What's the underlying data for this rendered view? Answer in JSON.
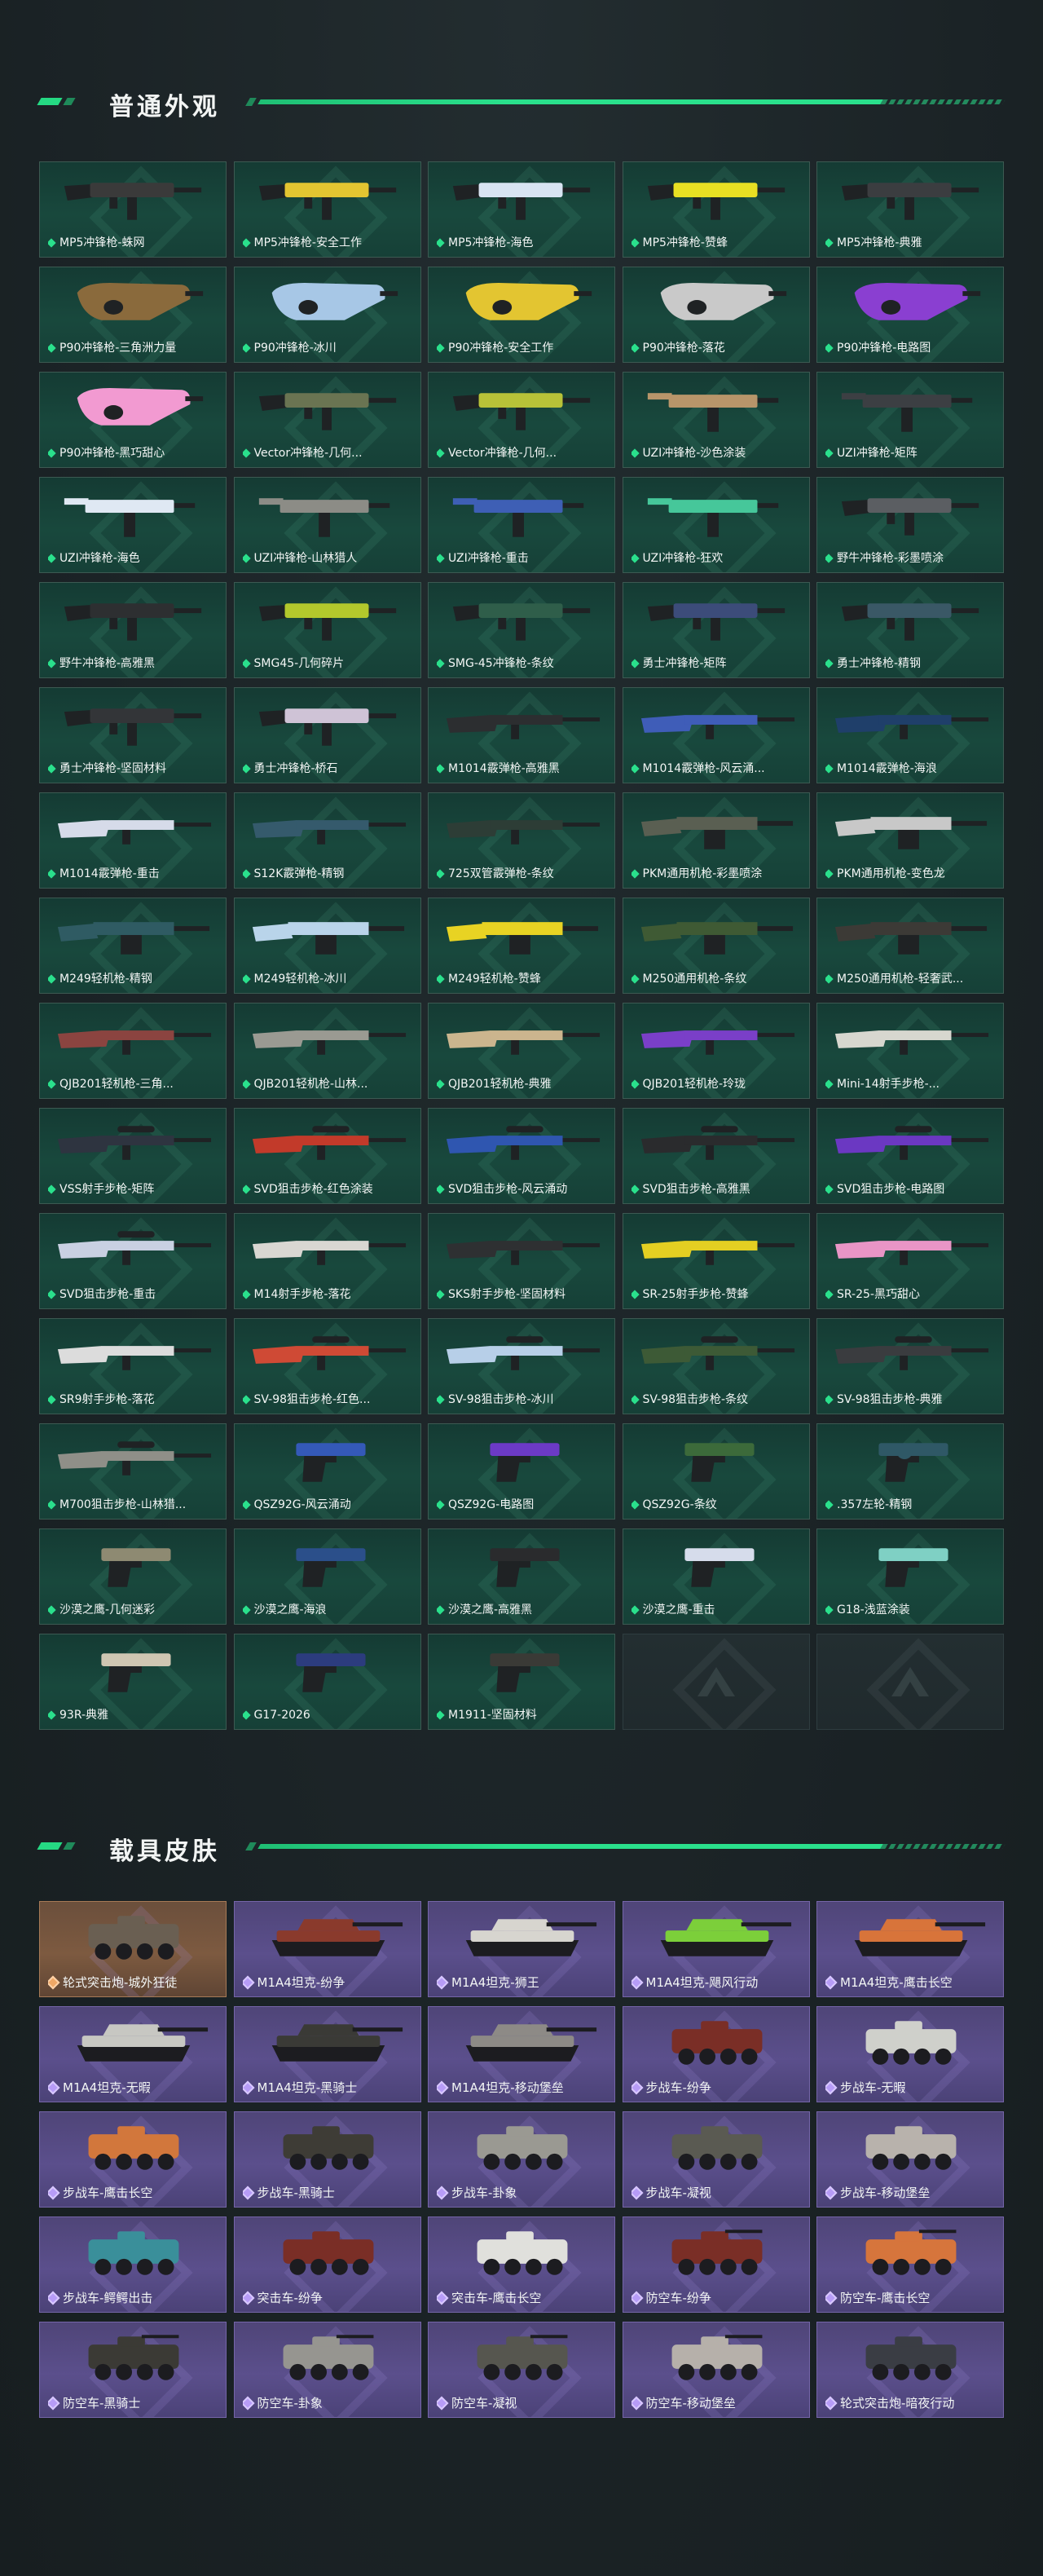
{
  "colors": {
    "accent": "#2ae08c",
    "weapon_card": "#184a3e",
    "vehicle_card": "#5b4f8c",
    "vehicle_legend_card": "#7d5a40",
    "page_bg": "#1c2427"
  },
  "weapons_section": {
    "title": "普通外观",
    "items": [
      {
        "label": "MP5冲锋枪-蛛网",
        "icon": "smg-icon",
        "tone": "#3a3a3a"
      },
      {
        "label": "MP5冲锋枪-安全工作",
        "icon": "smg-icon",
        "tone": "#e3c531"
      },
      {
        "label": "MP5冲锋枪-海色",
        "icon": "smg-icon",
        "tone": "#d8e4f2"
      },
      {
        "label": "MP5冲锋枪-赞蜂",
        "icon": "smg-icon",
        "tone": "#e8e023"
      },
      {
        "label": "MP5冲锋枪-典雅",
        "icon": "smg-icon",
        "tone": "#3b3d40"
      },
      {
        "label": "P90冲锋枪-三角洲力量",
        "icon": "p90-icon",
        "tone": "#8a6a3c"
      },
      {
        "label": "P90冲锋枪-冰川",
        "icon": "p90-icon",
        "tone": "#a7c7e6"
      },
      {
        "label": "P90冲锋枪-安全工作",
        "icon": "p90-icon",
        "tone": "#e3c531"
      },
      {
        "label": "P90冲锋枪-落花",
        "icon": "p90-icon",
        "tone": "#c9c9c9"
      },
      {
        "label": "P90冲锋枪-电路图",
        "icon": "p90-icon",
        "tone": "#8a3fd1"
      },
      {
        "label": "P90冲锋枪-黑巧甜心",
        "icon": "p90-icon",
        "tone": "#f29ad1"
      },
      {
        "label": "Vector冲锋枪-几何...",
        "icon": "smg-icon",
        "tone": "#6a7452"
      },
      {
        "label": "Vector冲锋枪-几何...",
        "icon": "smg-icon",
        "tone": "#b8c238"
      },
      {
        "label": "UZI冲锋枪-沙色涂装",
        "icon": "uzi-icon",
        "tone": "#b8956a"
      },
      {
        "label": "UZI冲锋枪-矩阵",
        "icon": "uzi-icon",
        "tone": "#3c3f43"
      },
      {
        "label": "UZI冲锋枪-海色",
        "icon": "uzi-icon",
        "tone": "#dfe8f3"
      },
      {
        "label": "UZI冲锋枪-山林猎人",
        "icon": "uzi-icon",
        "tone": "#8c8c86"
      },
      {
        "label": "UZI冲锋枪-重击",
        "icon": "uzi-icon",
        "tone": "#3e5fb5"
      },
      {
        "label": "UZI冲锋枪-狂欢",
        "icon": "uzi-icon",
        "tone": "#46c79a"
      },
      {
        "label": "野牛冲锋枪-彩墨喷涂",
        "icon": "smg-icon",
        "tone": "#5b5e62"
      },
      {
        "label": "野牛冲锋枪-高雅黑",
        "icon": "smg-icon",
        "tone": "#2d2f31"
      },
      {
        "label": "SMG45-几何碎片",
        "icon": "smg-icon",
        "tone": "#b3c82c"
      },
      {
        "label": "SMG-45冲锋枪-条纹",
        "icon": "smg-icon",
        "tone": "#2f5e4a"
      },
      {
        "label": "勇士冲锋枪-矩阵",
        "icon": "smg-icon",
        "tone": "#3c4c7a"
      },
      {
        "label": "勇士冲锋枪-精钢",
        "icon": "smg-icon",
        "tone": "#3a5866"
      },
      {
        "label": "勇士冲锋枪-坚固材料",
        "icon": "smg-icon",
        "tone": "#333538"
      },
      {
        "label": "勇士冲锋枪-桥石",
        "icon": "smg-icon",
        "tone": "#cfc3d6"
      },
      {
        "label": "M1014霰弹枪-高雅黑",
        "icon": "shotgun-icon",
        "tone": "#2c2e30"
      },
      {
        "label": "M1014霰弹枪-风云涌...",
        "icon": "shotgun-icon",
        "tone": "#3f5db8"
      },
      {
        "label": "M1014霰弹枪-海浪",
        "icon": "shotgun-icon",
        "tone": "#1f3f6a"
      },
      {
        "label": "M1014霰弹枪-重击",
        "icon": "shotgun-icon",
        "tone": "#d6dbe9"
      },
      {
        "label": "S12K霰弹枪-精钢",
        "icon": "shotgun-icon",
        "tone": "#355a6c"
      },
      {
        "label": "725双管霰弹枪-条纹",
        "icon": "shotgun-icon",
        "tone": "#2d3d36"
      },
      {
        "label": "PKM通用机枪-彩墨喷涂",
        "icon": "mg-icon",
        "tone": "#5a5f52"
      },
      {
        "label": "PKM通用机枪-变色龙",
        "icon": "mg-icon",
        "tone": "#c8c8c8"
      },
      {
        "label": "M249轻机枪-精钢",
        "icon": "mg-icon",
        "tone": "#2f5b63"
      },
      {
        "label": "M249轻机枪-冰川",
        "icon": "mg-icon",
        "tone": "#b9d4ea"
      },
      {
        "label": "M249轻机枪-赞蜂",
        "icon": "mg-icon",
        "tone": "#e8d323"
      },
      {
        "label": "M250通用机枪-条纹",
        "icon": "mg-icon",
        "tone": "#3f5a34"
      },
      {
        "label": "M250通用机枪-轻奢武...",
        "icon": "mg-icon",
        "tone": "#3c3a36"
      },
      {
        "label": "QJB201轻机枪-三角...",
        "icon": "rifle-icon",
        "tone": "#8b4440"
      },
      {
        "label": "QJB201轻机枪-山林...",
        "icon": "rifle-icon",
        "tone": "#9a9a92"
      },
      {
        "label": "QJB201轻机枪-典雅",
        "icon": "rifle-icon",
        "tone": "#cbb58e"
      },
      {
        "label": "QJB201轻机枪-玲珑",
        "icon": "rifle-icon",
        "tone": "#7a3fc8"
      },
      {
        "label": "Mini-14射手步枪-...",
        "icon": "rifle-icon",
        "tone": "#d7d7cf"
      },
      {
        "label": "VSS射手步枪-矩阵",
        "icon": "sniper-icon",
        "tone": "#2e3440"
      },
      {
        "label": "SVD狙击步枪-红色涂装",
        "icon": "sniper-icon",
        "tone": "#c23a2a"
      },
      {
        "label": "SVD狙击步枪-风云涌动",
        "icon": "sniper-icon",
        "tone": "#2f56b0"
      },
      {
        "label": "SVD狙击步枪-高雅黑",
        "icon": "sniper-icon",
        "tone": "#2a2b2d"
      },
      {
        "label": "SVD狙击步枪-电路图",
        "icon": "sniper-icon",
        "tone": "#6b38c2"
      },
      {
        "label": "SVD狙击步枪-重击",
        "icon": "sniper-icon",
        "tone": "#c9d0e2"
      },
      {
        "label": "M14射手步枪-落花",
        "icon": "rifle-icon",
        "tone": "#d9d7d2"
      },
      {
        "label": "SKS射手步枪-坚固材料",
        "icon": "rifle-icon",
        "tone": "#2e3032"
      },
      {
        "label": "SR-25射手步枪-赞蜂",
        "icon": "rifle-icon",
        "tone": "#e4cf22"
      },
      {
        "label": "SR-25-黑巧甜心",
        "icon": "rifle-icon",
        "tone": "#e995c6"
      },
      {
        "label": "SR9射手步枪-落花",
        "icon": "rifle-icon",
        "tone": "#dcdcdc"
      },
      {
        "label": "SV-98狙击步枪-红色...",
        "icon": "sniper-icon",
        "tone": "#cf4a35"
      },
      {
        "label": "SV-98狙击步枪-冰川",
        "icon": "sniper-icon",
        "tone": "#b7cfe8"
      },
      {
        "label": "SV-98狙击步枪-条纹",
        "icon": "sniper-icon",
        "tone": "#3d5a36"
      },
      {
        "label": "SV-98狙击步枪-典雅",
        "icon": "sniper-icon",
        "tone": "#3a3c3f"
      },
      {
        "label": "M700狙击步枪-山林猎...",
        "icon": "sniper-icon",
        "tone": "#8f8f88"
      },
      {
        "label": "QSZ92G-风云涌动",
        "icon": "pistol-icon",
        "tone": "#3459b8"
      },
      {
        "label": "QSZ92G-电路图",
        "icon": "pistol-icon",
        "tone": "#6c3ac6"
      },
      {
        "label": "QSZ92G-条纹",
        "icon": "pistol-icon",
        "tone": "#3c6a3a"
      },
      {
        "label": ".357左轮-精钢",
        "icon": "revolver-icon",
        "tone": "#2f5866"
      },
      {
        "label": "沙漠之鹰-几何迷彩",
        "icon": "pistol-icon",
        "tone": "#8e8a72"
      },
      {
        "label": "沙漠之鹰-海浪",
        "icon": "pistol-icon",
        "tone": "#2b4f8a"
      },
      {
        "label": "沙漠之鹰-高雅黑",
        "icon": "pistol-icon",
        "tone": "#2a2b2d"
      },
      {
        "label": "沙漠之鹰-重击",
        "icon": "pistol-icon",
        "tone": "#d6dceb"
      },
      {
        "label": "G18-浅蓝涂装",
        "icon": "pistol-icon",
        "tone": "#7fd0c4"
      },
      {
        "label": "93R-典雅",
        "icon": "pistol-icon",
        "tone": "#cfc6b2"
      },
      {
        "label": "G17-2026",
        "icon": "pistol-icon",
        "tone": "#2c3c7e"
      },
      {
        "label": "M1911-坚固材料",
        "icon": "pistol-icon",
        "tone": "#3a3a36"
      }
    ],
    "empty_slots": 2
  },
  "vehicles_section": {
    "title": "载具皮肤",
    "items": [
      {
        "label": "轮式突击炮-城外狂徒",
        "icon": "armored-car-icon",
        "tone": "#6a5f52",
        "legend": true
      },
      {
        "label": "M1A4坦克-纷争",
        "icon": "tank-icon",
        "tone": "#8a3a2c",
        "legend": false
      },
      {
        "label": "M1A4坦克-狮王",
        "icon": "tank-icon",
        "tone": "#d7d5cf",
        "legend": false
      },
      {
        "label": "M1A4坦克-飓风行动",
        "icon": "tank-icon",
        "tone": "#7ccf3a",
        "legend": false
      },
      {
        "label": "M1A4坦克-鹰击长空",
        "icon": "tank-icon",
        "tone": "#d8743a",
        "legend": false
      },
      {
        "label": "M1A4坦克-无暇",
        "icon": "tank-icon",
        "tone": "#c7c7c2",
        "legend": false
      },
      {
        "label": "M1A4坦克-黑骑士",
        "icon": "tank-icon",
        "tone": "#3a3a36",
        "legend": false
      },
      {
        "label": "M1A4坦克-移动堡垒",
        "icon": "tank-icon",
        "tone": "#8d8a86",
        "legend": false
      },
      {
        "label": "步战车-纷争",
        "icon": "ifv-icon",
        "tone": "#7a2e26",
        "legend": false
      },
      {
        "label": "步战车-无暇",
        "icon": "ifv-icon",
        "tone": "#cfd0cb",
        "legend": false
      },
      {
        "label": "步战车-鹰击长空",
        "icon": "ifv-icon",
        "tone": "#d2773c",
        "legend": false
      },
      {
        "label": "步战车-黑骑士",
        "icon": "ifv-icon",
        "tone": "#3e3c36",
        "legend": false
      },
      {
        "label": "步战车-卦象",
        "icon": "ifv-icon",
        "tone": "#9a9992",
        "legend": false
      },
      {
        "label": "步战车-凝视",
        "icon": "ifv-icon",
        "tone": "#5a5a52",
        "legend": false
      },
      {
        "label": "步战车-移动堡垒",
        "icon": "ifv-icon",
        "tone": "#b8b2ac",
        "legend": false
      },
      {
        "label": "步战车-鳄鳄出击",
        "icon": "ifv-icon",
        "tone": "#3a8f9a",
        "legend": false
      },
      {
        "label": "突击车-纷争",
        "icon": "assault-car-icon",
        "tone": "#7a2e26",
        "legend": false
      },
      {
        "label": "突击车-鹰击长空",
        "icon": "assault-car-icon",
        "tone": "#e0e0dc",
        "legend": false
      },
      {
        "label": "防空车-纷争",
        "icon": "aa-vehicle-icon",
        "tone": "#7a2e26",
        "legend": false
      },
      {
        "label": "防空车-鹰击长空",
        "icon": "aa-vehicle-icon",
        "tone": "#d6753c",
        "legend": false
      },
      {
        "label": "防空车-黑骑士",
        "icon": "aa-vehicle-icon",
        "tone": "#3b3a35",
        "legend": false
      },
      {
        "label": "防空车-卦象",
        "icon": "aa-vehicle-icon",
        "tone": "#969590",
        "legend": false
      },
      {
        "label": "防空车-凝视",
        "icon": "aa-vehicle-icon",
        "tone": "#56564f",
        "legend": false
      },
      {
        "label": "防空车-移动堡垒",
        "icon": "aa-vehicle-icon",
        "tone": "#b6b0aa",
        "legend": false
      },
      {
        "label": "轮式突击炮-暗夜行动",
        "icon": "armored-car-icon",
        "tone": "#3a3d44",
        "legend": false
      }
    ]
  }
}
